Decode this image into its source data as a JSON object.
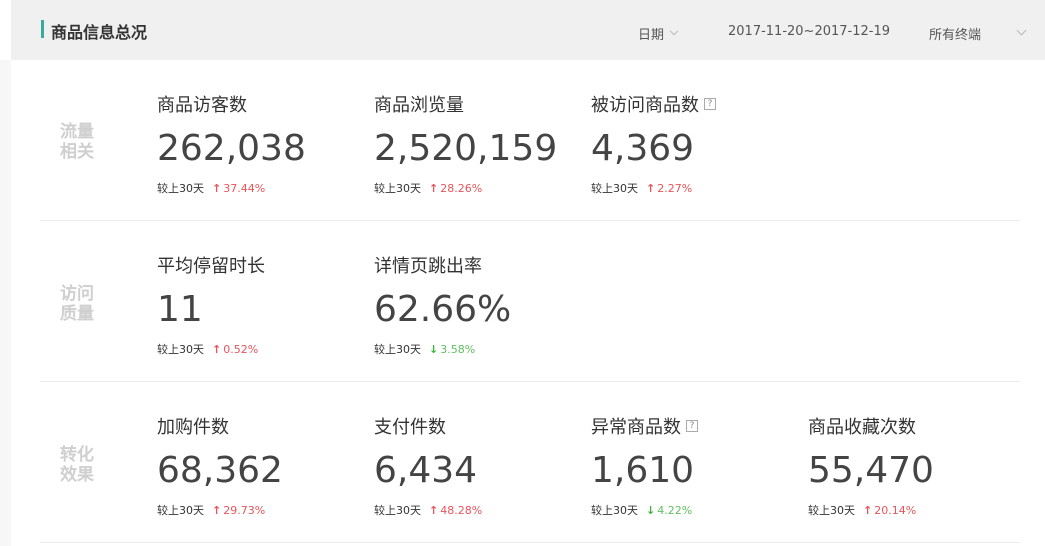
{
  "header": {
    "title": "商品信息总况",
    "date_label": "日期",
    "date_range": "2017-11-20~2017-12-19",
    "terminal_label": "所有终端"
  },
  "sections": [
    {
      "category": "流量相关",
      "category_lines": [
        "流量",
        "相关"
      ],
      "metrics": [
        {
          "label": "商品访客数",
          "value": "262,038",
          "compare": "较上30天",
          "direction": "up",
          "change": "37.44%"
        },
        {
          "label": "商品浏览量",
          "value": "2,520,159",
          "compare": "较上30天",
          "direction": "up",
          "change": "28.26%"
        },
        {
          "label": "被访问商品数",
          "value": "4,369",
          "compare": "较上30天",
          "direction": "up",
          "change": "2.27%",
          "help": "?"
        }
      ]
    },
    {
      "category": "访问质量",
      "category_lines": [
        "访问",
        "质量"
      ],
      "metrics": [
        {
          "label": "平均停留时长",
          "value": "11",
          "compare": "较上30天",
          "direction": "up",
          "change": "0.52%"
        },
        {
          "label": "详情页跳出率",
          "value": "62.66%",
          "compare": "较上30天",
          "direction": "down",
          "change": "3.58%"
        }
      ]
    },
    {
      "category": "转化效果",
      "category_lines": [
        "转化",
        "效果"
      ],
      "metrics": [
        {
          "label": "加购件数",
          "value": "68,362",
          "compare": "较上30天",
          "direction": "up",
          "change": "29.73%"
        },
        {
          "label": "支付件数",
          "value": "6,434",
          "compare": "较上30天",
          "direction": "up",
          "change": "48.28%"
        },
        {
          "label": "异常商品数",
          "value": "1,610",
          "compare": "较上30天",
          "direction": "down",
          "change": "4.22%",
          "help": "?"
        },
        {
          "label": "商品收藏次数",
          "value": "55,470",
          "compare": "较上30天",
          "direction": "up",
          "change": "20.14%"
        }
      ]
    }
  ],
  "colors": {
    "accent": "#3aa9a0",
    "up": "#e8545a",
    "down": "#3ab53a",
    "category": "#cfcfcf"
  }
}
